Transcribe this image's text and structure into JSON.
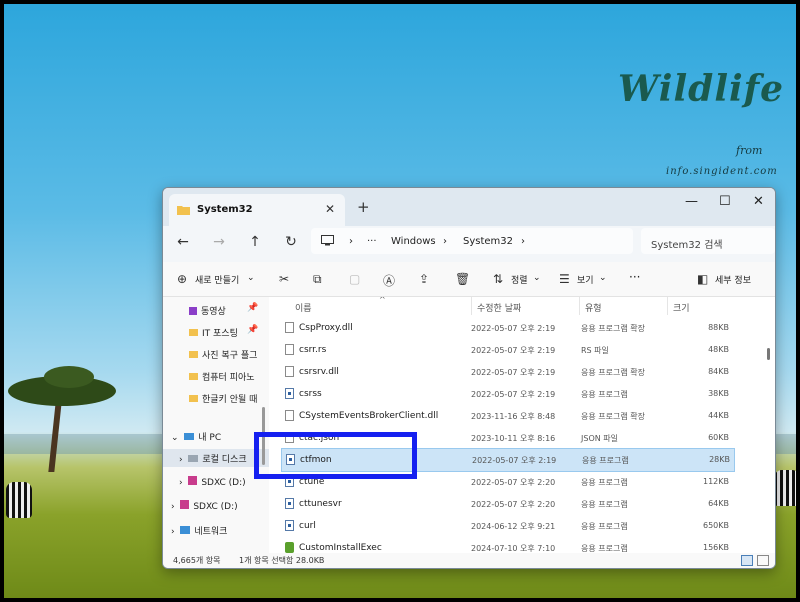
{
  "wallpaper": {
    "title": "Wildlife",
    "from_text": "from",
    "site": "info.singident.com"
  },
  "window": {
    "tab_title": "System32",
    "tab_close": "✕",
    "new_tab": "+",
    "minimize": "—",
    "maximize": "☐",
    "close": "✕"
  },
  "address": {
    "back": "←",
    "forward": "→",
    "up": "↑",
    "refresh": "↻",
    "ellipsis": "···",
    "crumbs": [
      "Windows",
      "System32"
    ],
    "search_placeholder": "System32 검색"
  },
  "toolbar": {
    "new_label": "새로 만들기",
    "sort_label": "정렬",
    "view_label": "보기",
    "more": "···",
    "details_label": "세부 정보"
  },
  "nav": {
    "quick": [
      {
        "label": "동영상",
        "icon": "video-icon"
      },
      {
        "label": "IT 포스팅",
        "icon": "folder-icon"
      },
      {
        "label": "사진 복구 플그",
        "icon": "folder-icon"
      },
      {
        "label": "컴퓨터 피아노",
        "icon": "folder-icon"
      },
      {
        "label": "한글키 안될 때",
        "icon": "folder-icon"
      }
    ],
    "this_pc": "내 PC",
    "local_disk": "로컬 디스크",
    "sdxc1": "SDXC (D:)",
    "sdxc2": "SDXC (D:)",
    "network": "네트워크"
  },
  "columns": {
    "name": "이름",
    "date": "수정한 날짜",
    "type": "유형",
    "size": "크기"
  },
  "files": [
    {
      "name": "CspProxy.dll",
      "date": "2022-05-07 오후 2:19",
      "type": "응용 프로그램 확장",
      "size": "88KB",
      "icon": "dll-icon"
    },
    {
      "name": "csrr.rs",
      "date": "2022-05-07 오후 2:19",
      "type": "RS 파일",
      "size": "48KB",
      "icon": "file-icon"
    },
    {
      "name": "csrsrv.dll",
      "date": "2022-05-07 오후 2:19",
      "type": "응용 프로그램 확장",
      "size": "84KB",
      "icon": "dll-icon"
    },
    {
      "name": "csrss",
      "date": "2022-05-07 오후 2:19",
      "type": "응용 프로그램",
      "size": "38KB",
      "icon": "exe-icon"
    },
    {
      "name": "CSystemEventsBrokerClient.dll",
      "date": "2023-11-16 오후 8:48",
      "type": "응용 프로그램 확장",
      "size": "44KB",
      "icon": "dll-icon"
    },
    {
      "name": "ctac.json",
      "date": "2023-10-11 오후 8:16",
      "type": "JSON 파일",
      "size": "60KB",
      "icon": "file-icon"
    },
    {
      "name": "ctfmon",
      "date": "2022-05-07 오후 2:19",
      "type": "응용 프로그램",
      "size": "28KB",
      "icon": "exe-icon"
    },
    {
      "name": "ctune",
      "date": "2022-05-07 오후 2:20",
      "type": "응용 프로그램",
      "size": "112KB",
      "icon": "exe-icon"
    },
    {
      "name": "cttunesvr",
      "date": "2022-05-07 오후 2:20",
      "type": "응용 프로그램",
      "size": "64KB",
      "icon": "exe-icon"
    },
    {
      "name": "curl",
      "date": "2024-06-12 오후 9:21",
      "type": "응용 프로그램",
      "size": "650KB",
      "icon": "exe-icon"
    },
    {
      "name": "CustomInstallExec",
      "date": "2024-07-10 오후 7:10",
      "type": "응용 프로그램",
      "size": "156KB",
      "icon": "installer-icon"
    }
  ],
  "status": {
    "count": "4,665개 항목",
    "selection": "1개 항목 선택함 28.0KB"
  },
  "colors": {
    "highlight_box": "#1520f0",
    "selection": "#cce4f7"
  }
}
